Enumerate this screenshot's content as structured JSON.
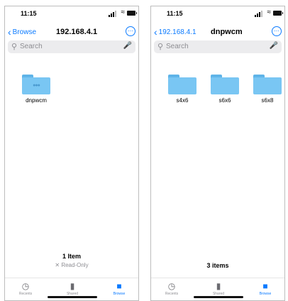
{
  "screens": [
    {
      "status": {
        "time": "11:15"
      },
      "nav": {
        "back_label": "Browse",
        "title": "192.168.4.1"
      },
      "search": {
        "placeholder": "Search"
      },
      "items": [
        {
          "name": "dnpwcm",
          "icon": "shared-folder-icon"
        }
      ],
      "footer": {
        "count": "1 Item",
        "sub": "✕ Read-Only"
      },
      "tabs": [
        {
          "label": "Recents",
          "icon": "clock-icon"
        },
        {
          "label": "Shared",
          "icon": "shared-folder-icon"
        },
        {
          "label": "Browse",
          "icon": "folder-icon",
          "active": true
        }
      ]
    },
    {
      "status": {
        "time": "11:15"
      },
      "nav": {
        "back_label": "192.168.4.1",
        "title": "dnpwcm"
      },
      "search": {
        "placeholder": "Search"
      },
      "items": [
        {
          "name": "s4x6"
        },
        {
          "name": "s6x6"
        },
        {
          "name": "s6x8"
        }
      ],
      "footer": {
        "count": "3 items"
      },
      "tabs": [
        {
          "label": "Recents",
          "icon": "clock-icon"
        },
        {
          "label": "Shared",
          "icon": "shared-folder-icon"
        },
        {
          "label": "Browse",
          "icon": "folder-icon",
          "active": true
        }
      ]
    }
  ],
  "colors": {
    "accent": "#0a7aff",
    "folder": "#79c6f3"
  }
}
